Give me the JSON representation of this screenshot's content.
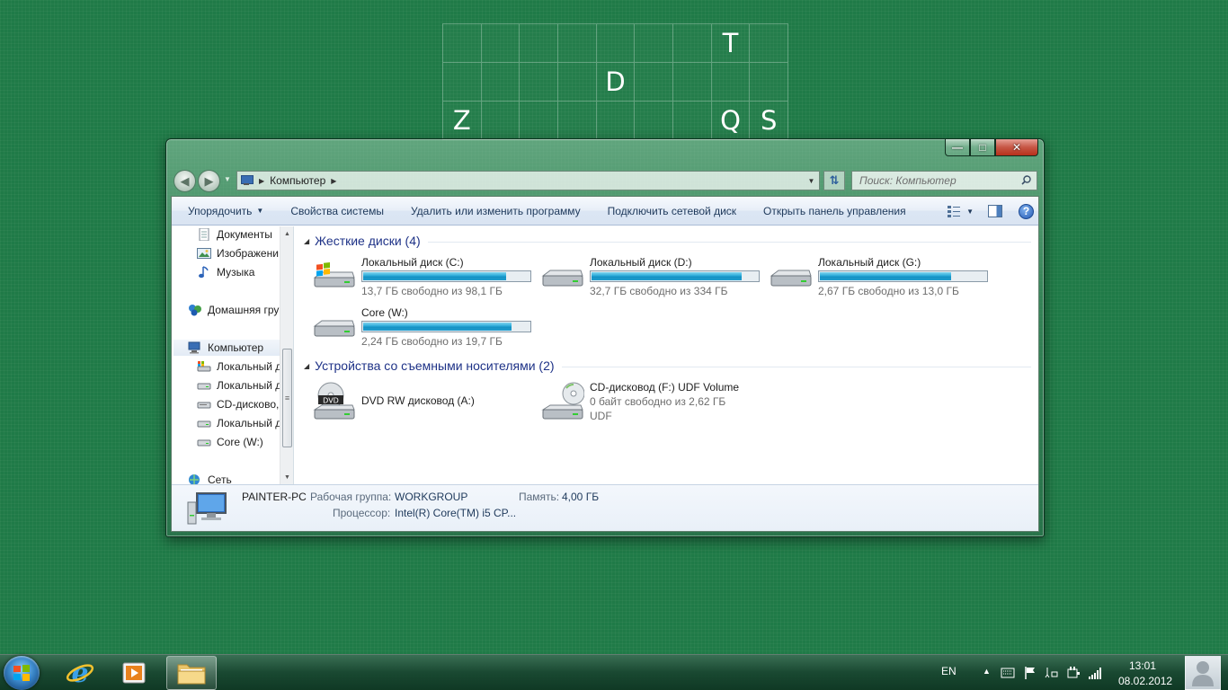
{
  "desktop": {
    "tiles": [
      "",
      "",
      "",
      "",
      "",
      "",
      "",
      "T",
      "",
      "",
      "",
      "",
      "",
      "D",
      "",
      "",
      "",
      "",
      "Z",
      "",
      "",
      "",
      "",
      "",
      "",
      "Q",
      "S"
    ]
  },
  "window": {
    "buttons": {
      "minimize": "—",
      "maximize": "□",
      "close": "✕"
    },
    "address": {
      "crumb": "Компьютер"
    },
    "search": {
      "placeholder": "Поиск: Компьютер"
    },
    "toolbar": {
      "organize": "Упорядочить",
      "system_properties": "Свойства системы",
      "uninstall": "Удалить или изменить программу",
      "map_drive": "Подключить сетевой диск",
      "control_panel": "Открыть панель управления",
      "help": "?"
    },
    "navpane": {
      "documents": "Документы",
      "images": "Изображени",
      "music": "Музыка",
      "homegroup": "Домашняя гру",
      "computer": "Компьютер",
      "drive1": "Локальный д",
      "drive2": "Локальный д",
      "cd": "CD-дисково,",
      "drive3": "Локальный д",
      "core": "Core (W:)",
      "network": "Сеть"
    },
    "groups": {
      "hdd": "Жесткие диски (4)",
      "removable": "Устройства со съемными носителями (2)"
    },
    "drives": [
      {
        "name": "Локальный диск (C:)",
        "free_text": "13,7 ГБ свободно из 98,1 ГБ",
        "used_fraction": 0.86
      },
      {
        "name": "Локальный диск (D:)",
        "free_text": "32,7 ГБ свободно из 334 ГБ",
        "used_fraction": 0.9
      },
      {
        "name": "Локальный диск (G:)",
        "free_text": "2,67 ГБ свободно из 13,0 ГБ",
        "used_fraction": 0.79
      },
      {
        "name": "Core (W:)",
        "free_text": "2,24 ГБ свободно из 19,7 ГБ",
        "used_fraction": 0.89
      }
    ],
    "devices": {
      "dvd": {
        "name": "DVD RW дисковод (A:)",
        "badge": "DVD"
      },
      "cd": {
        "name": "CD-дисковод (F:) UDF Volume",
        "free_text": "0 байт свободно из 2,62 ГБ",
        "fs": "UDF"
      }
    },
    "details": {
      "pc_name": "PAINTER-PC",
      "workgroup_label": "Рабочая группа:",
      "workgroup_value": "WORKGROUP",
      "memory_label": "Память:",
      "memory_value": "4,00 ГБ",
      "cpu_label": "Процессор:",
      "cpu_value": "Intel(R) Core(TM) i5 CP..."
    }
  },
  "taskbar": {
    "lang": "EN",
    "time": "13:01",
    "date": "08.02.2012"
  }
}
